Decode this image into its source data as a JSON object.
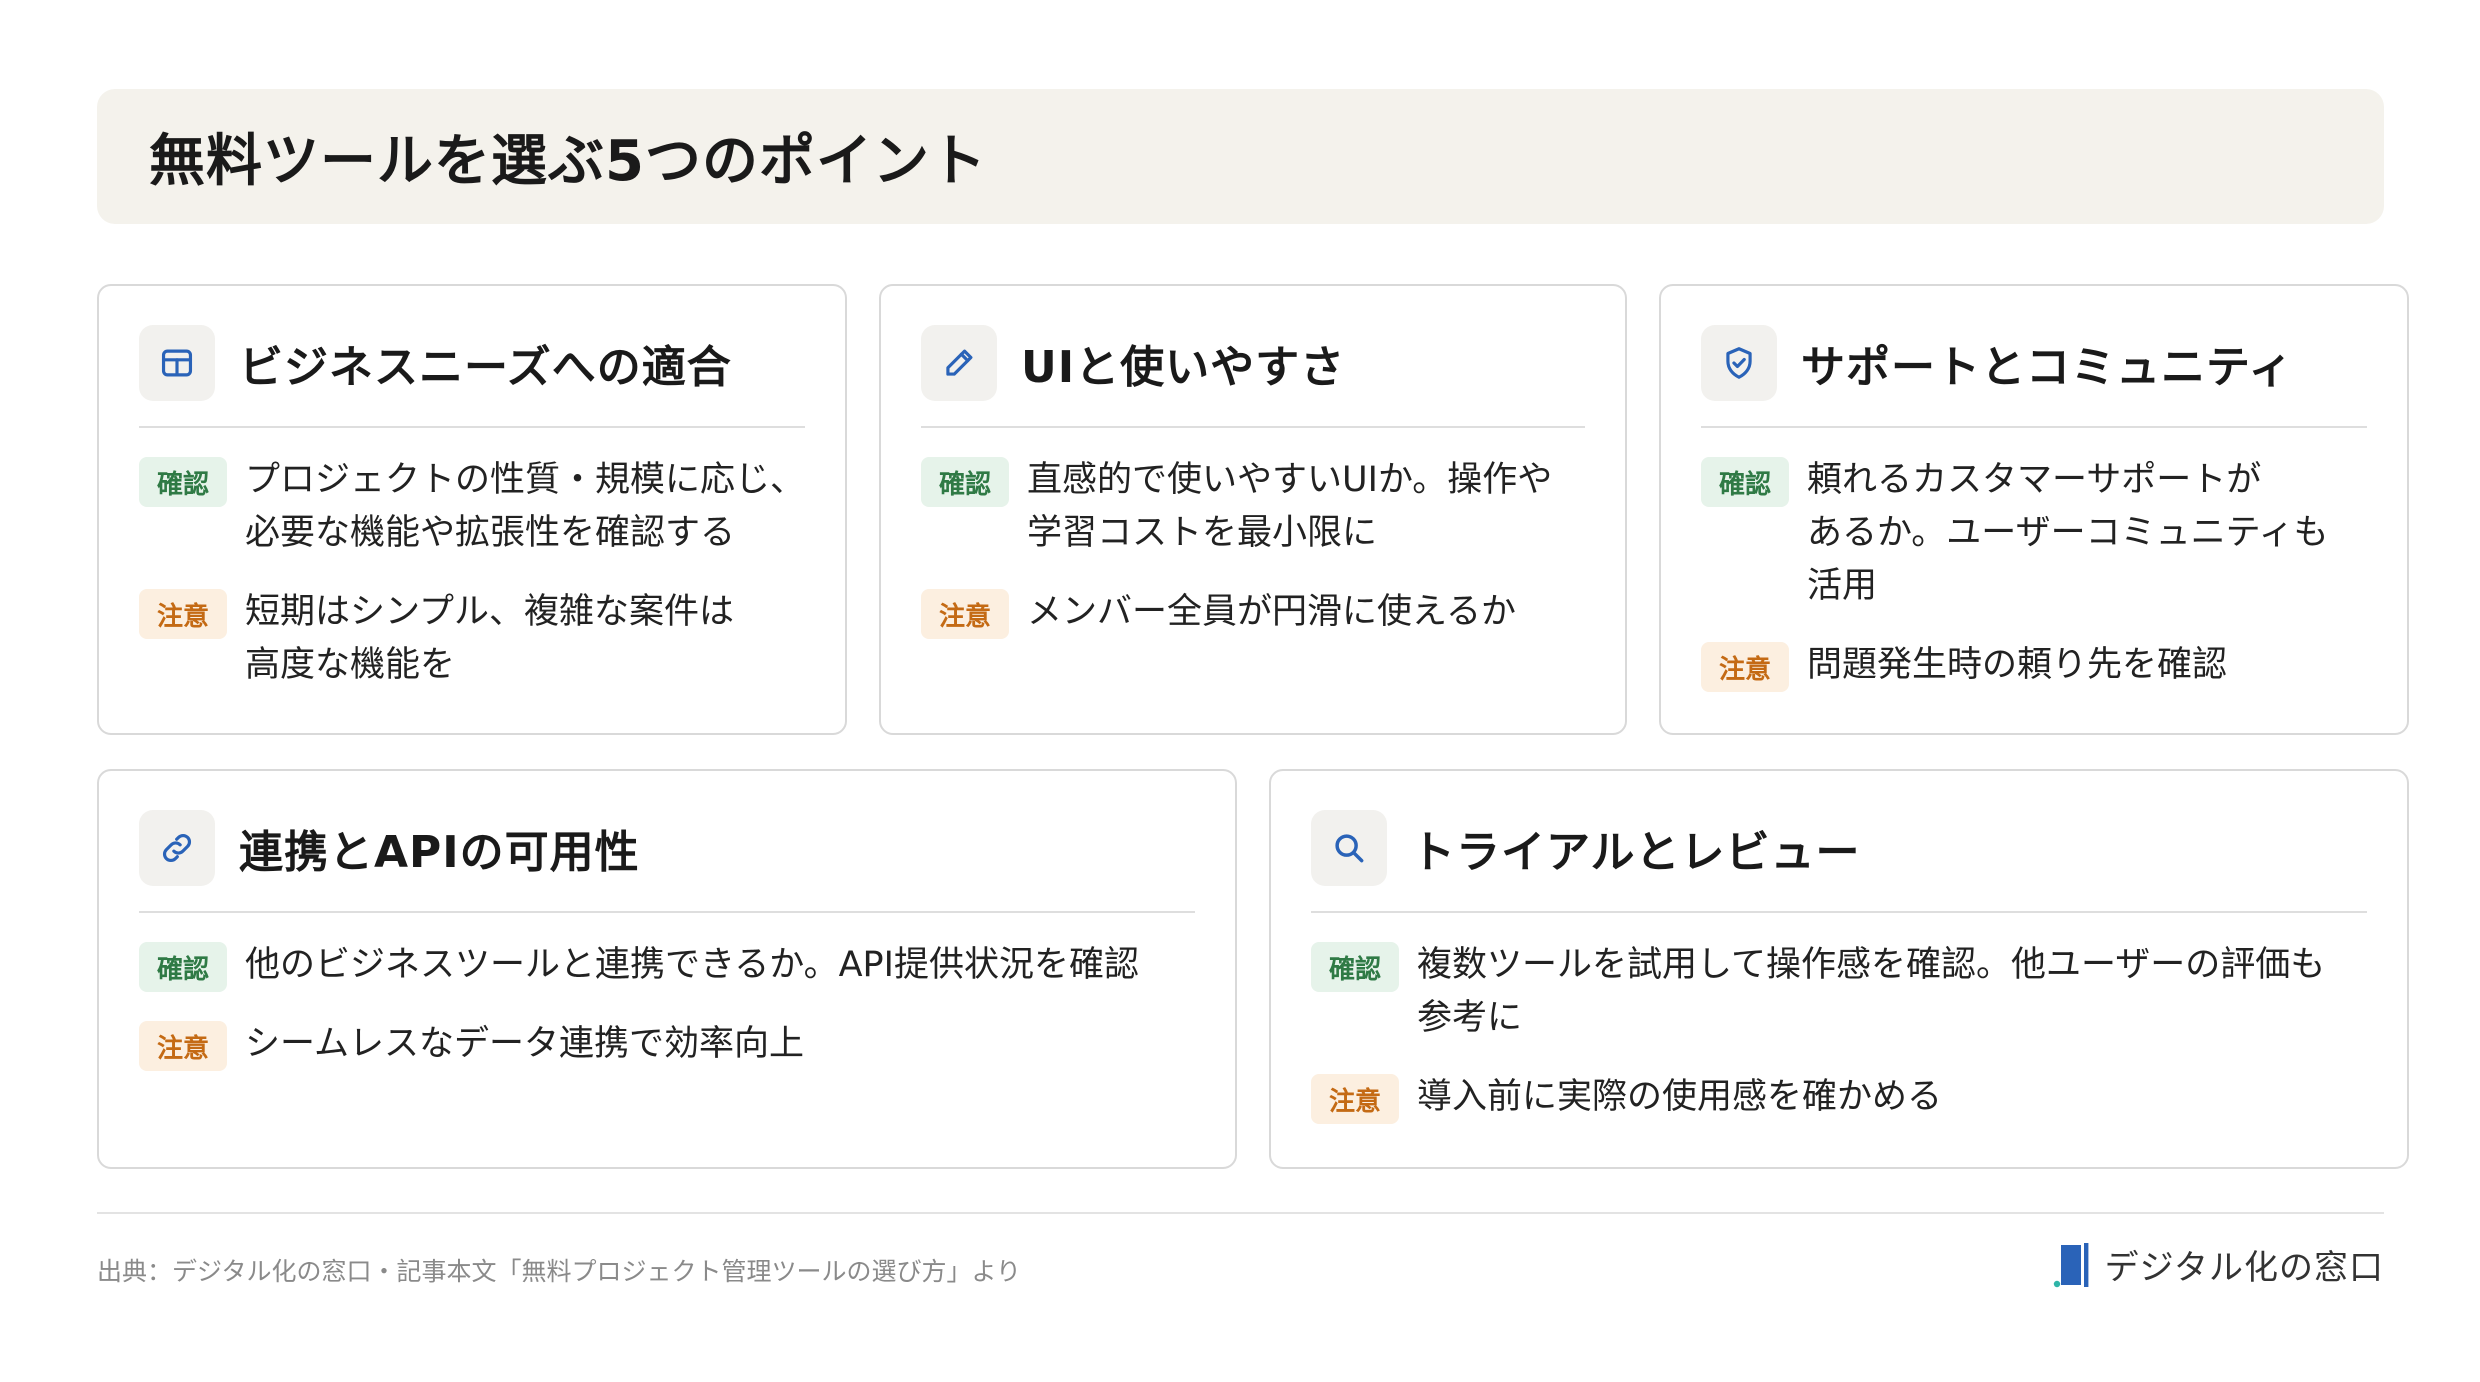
{
  "title": "無料ツールを選ぶ5つのポイント",
  "badges": {
    "check": "確認",
    "warn": "注意"
  },
  "cards": [
    {
      "icon": "grid-icon",
      "title": "ビジネスニーズへの適合",
      "check_lines": [
        "プロジェクトの性質・規模に応じ、",
        "必要な機能や拡張性を確認する"
      ],
      "warn_lines": [
        "短期はシンプル、複雑な案件は",
        "高度な機能を"
      ]
    },
    {
      "icon": "pencil-icon",
      "title": "UIと使いやすさ",
      "check_lines": [
        "直感的で使いやすいUIか。操作や",
        "学習コストを最小限に"
      ],
      "warn_lines": [
        "メンバー全員が円滑に使えるか"
      ]
    },
    {
      "icon": "shield-check-icon",
      "title": "サポートとコミュニティ",
      "check_lines": [
        "頼れるカスタマーサポートが",
        "あるか。ユーザーコミュニティも",
        "活用"
      ],
      "warn_lines": [
        "問題発生時の頼り先を確認"
      ]
    },
    {
      "icon": "link-icon",
      "title": "連携とAPIの可用性",
      "check_lines": [
        "他のビジネスツールと連携できるか。API提供状況を確認"
      ],
      "warn_lines": [
        "シームレスなデータ連携で効率向上"
      ]
    },
    {
      "icon": "search-icon",
      "title": "トライアルとレビュー",
      "check_lines": [
        "複数ツールを試用して操作感を確認。他ユーザーの評価も",
        "参考に"
      ],
      "warn_lines": [
        "導入前に実際の使用感を確かめる"
      ]
    }
  ],
  "footer": {
    "source": "出典：デジタル化の窓口・記事本文「無料プロジェクト管理ツールの選び方」より",
    "brand": "デジタル化の窓口"
  },
  "colors": {
    "icon_blue": "#2a63b8",
    "check_bg": "#e6f3ea",
    "check_text": "#2f7a45",
    "warn_bg": "#fcefe0",
    "warn_text": "#c46a14",
    "title_bg": "#f4f2ec"
  }
}
